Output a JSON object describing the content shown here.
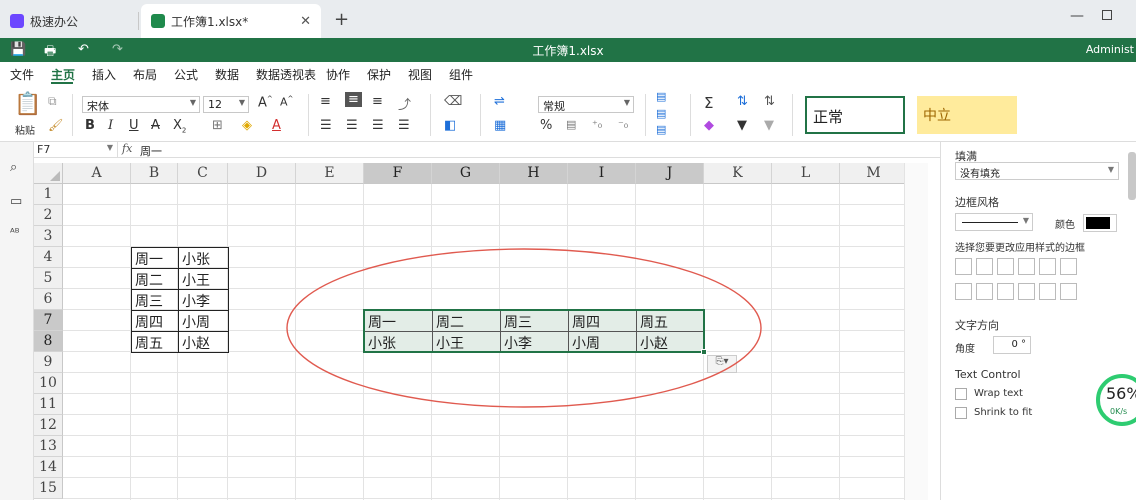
{
  "tabs": [
    {
      "title": "极速办公",
      "active": false
    },
    {
      "title": "工作簿1.xlsx*",
      "active": true
    }
  ],
  "titlebar": {
    "title": "工作簿1.xlsx",
    "user": "Administ"
  },
  "menu": [
    "文件",
    "主页",
    "插入",
    "布局",
    "公式",
    "数据",
    "数据透视表",
    "协作",
    "保护",
    "视图",
    "组件"
  ],
  "menu_active": "主页",
  "ribbon": {
    "paste_label": "粘贴",
    "font_name": "宋体",
    "font_size": "12",
    "number_format": "常规",
    "styles": {
      "normal": "正常",
      "neutral": "中立"
    },
    "bold": "B",
    "italic": "I",
    "underline": "U",
    "strike": "A"
  },
  "formula_bar": {
    "name_box": "F7",
    "fx": "fx",
    "content": "周一"
  },
  "grid": {
    "columns": [
      "A",
      "B",
      "C",
      "D",
      "E",
      "F",
      "G",
      "H",
      "I",
      "J",
      "K",
      "L",
      "M"
    ],
    "rows": [
      "1",
      "2",
      "3",
      "4",
      "5",
      "6",
      "7",
      "8",
      "9",
      "10",
      "11",
      "12",
      "13",
      "14",
      "15"
    ],
    "selected_columns": [
      "F",
      "G",
      "H",
      "I",
      "J"
    ],
    "selected_rows": [
      "7",
      "8"
    ],
    "table_left": [
      [
        "周一",
        "小张"
      ],
      [
        "周二",
        "小王"
      ],
      [
        "周三",
        "小李"
      ],
      [
        "周四",
        "小周"
      ],
      [
        "周五",
        "小赵"
      ]
    ],
    "table_transposed": [
      [
        "周一",
        "周二",
        "周三",
        "周四",
        "周五"
      ],
      [
        "小张",
        "小王",
        "小李",
        "小周",
        "小赵"
      ]
    ]
  },
  "panel": {
    "fill_title": "填满",
    "fill_value": "没有填充",
    "border_title": "边框风格",
    "color_label": "颜色",
    "border_hint": "选择您要更改应用样式的边框",
    "text_dir_title": "文字方向",
    "angle_label": "角度",
    "angle_value": "0 °",
    "text_control_title": "Text Control",
    "wrap_text": "Wrap text",
    "shrink_to_fit": "Shrink to fit"
  },
  "speed_widget": {
    "percent": "56%",
    "rate": "0K/s"
  },
  "colors": {
    "brand_green": "#217346",
    "selection_fill": "#e3ede7",
    "ellipse": "#e05a4f",
    "neutral_fill": "#ffeb9c"
  }
}
